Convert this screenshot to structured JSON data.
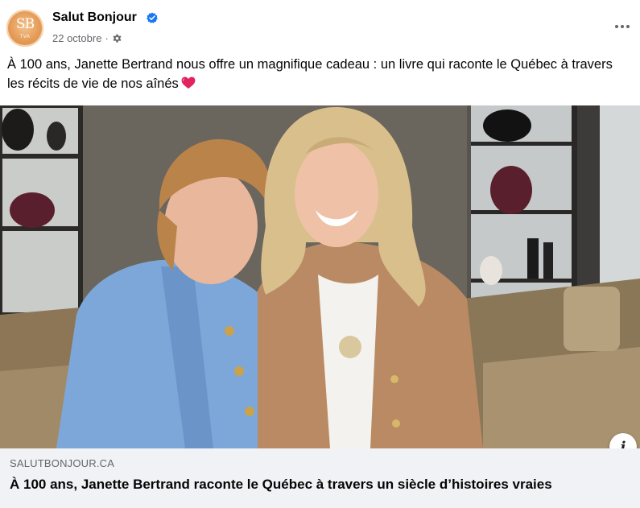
{
  "post": {
    "page_name": "Salut Bonjour",
    "verified_icon": "verified-badge-icon",
    "date": "22 octobre",
    "separator": "·",
    "audience_icon": "gear-icon",
    "more_icon": "more-options-icon",
    "text": "À 100 ans, Janette Bertrand nous offre un magnifique cadeau : un livre qui raconte le Québec à travers les récits de vie de nos aînés",
    "emoji_icon": "red-heart-icon"
  },
  "avatar": {
    "monogram": "SB",
    "subtext": "TVA"
  },
  "link_preview": {
    "domain": "SALUTBONJOUR.CA",
    "title": "À 100 ans, Janette Bertrand raconte le Québec à travers un siècle d’histoires vraies",
    "info_label": "i"
  },
  "colors": {
    "accent_blue": "#1877f2",
    "secondary_text": "#65676b",
    "card_background": "#f0f2f5",
    "heart_red": "#e0245e"
  }
}
